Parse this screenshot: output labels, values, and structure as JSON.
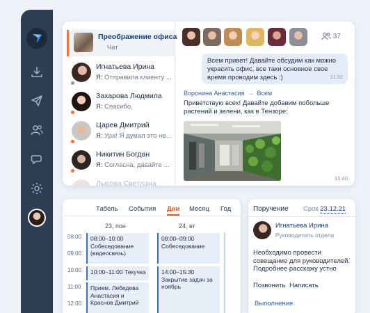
{
  "chats": [
    {
      "name": "Преображение офиса",
      "sub": "Чат",
      "prefix": ""
    },
    {
      "name": "Игнатьева Ирина",
      "sub": "Отправила клиенту ...",
      "prefix": "Я:"
    },
    {
      "name": "Захарова Людмила",
      "sub": "Спасибо.",
      "prefix": "Я:"
    },
    {
      "name": "Царев Дмитрий",
      "sub": "Ура! Я думал это не...",
      "prefix": "Я:"
    },
    {
      "name": "Никитин Богдан",
      "sub": "Согласна, давайте ...",
      "prefix": "Я:"
    },
    {
      "name": "Лысова Светлана",
      "sub": "",
      "prefix": ""
    }
  ],
  "participants_count": "37",
  "own_message": {
    "text": "Всем привет! Давайте обсудим как можно украсить офис, все таки основное свое время проводим здесь :)",
    "time": "11:32"
  },
  "incoming": {
    "from": "Воронина Анастасия",
    "to": "Всем",
    "text": "Приветствую всех! Давайте добавим побольше растений и зелени, как в Тензоре:",
    "time": "15:40"
  },
  "calendar": {
    "tabs": [
      "Табель",
      "События",
      "Дни",
      "Месяц",
      "Год"
    ],
    "active_tab": "Дни",
    "days": [
      "23, пон",
      "24, вт"
    ],
    "hours": [
      "08:00",
      "09:00",
      "10:00",
      "11:00",
      "12:00"
    ],
    "events": [
      {
        "time": "08:00–10:00",
        "title": "Собеседование (видеосвязь)"
      },
      {
        "time": "10:00–11:00",
        "title": "Текучка"
      },
      {
        "time": "",
        "title": "Прием. Лебедева Анастасия и Краснов Дмитрий"
      },
      {
        "time": "08:00–09:00",
        "title": "Собеседование"
      },
      {
        "time": "14:00–15:30",
        "title": "Закрытие задач за ноябрь"
      }
    ]
  },
  "task": {
    "title": "Поручение",
    "due_label": "Срок",
    "due_date": "23.12.21",
    "person": "Игнатьева Ирина",
    "role": "Руководитель отдела",
    "text": "Необходимо провести совещание для руководителей. Подробнее расскажу устно",
    "actions": [
      "Позвонить",
      "Написать"
    ],
    "done": "Выполнение"
  },
  "colors": {
    "accent": "#e8561e",
    "sidebar": "#2d3d52",
    "link": "#1b3f89"
  }
}
